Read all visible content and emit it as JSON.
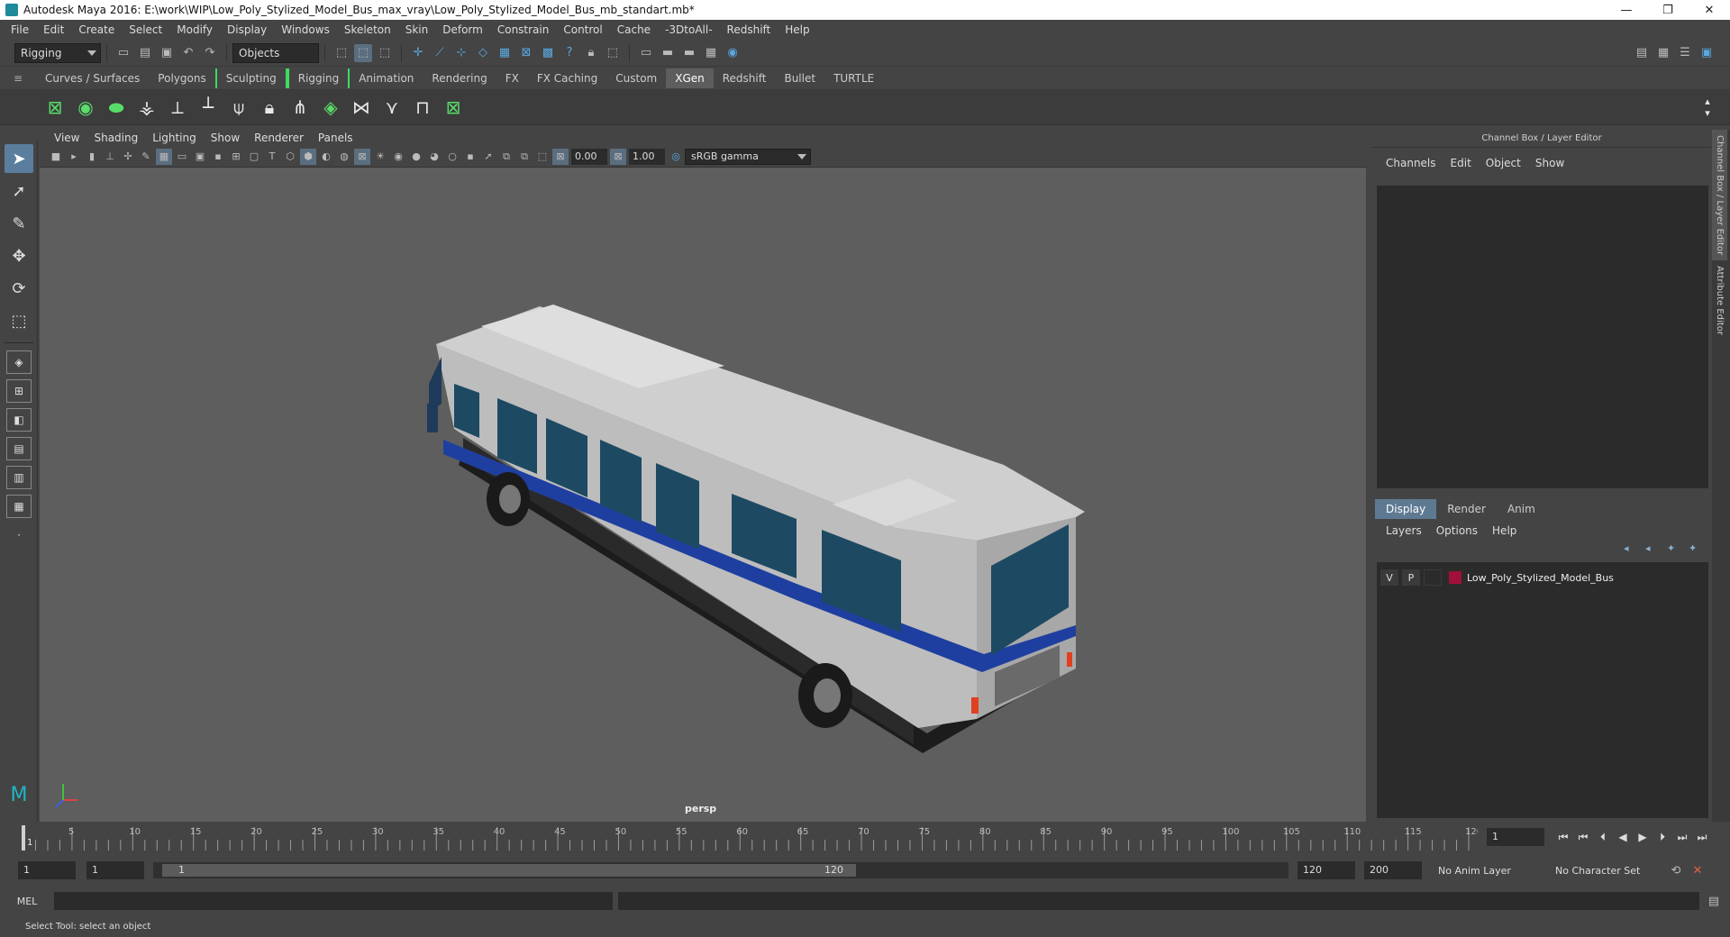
{
  "window": {
    "title": "Autodesk Maya 2016: E:\\work\\WIP\\Low_Poly_Stylized_Model_Bus_max_vray\\Low_Poly_Stylized_Model_Bus_mb_standart.mb*",
    "minimize": "—",
    "restore": "❐",
    "close": "✕"
  },
  "menubar": [
    "File",
    "Edit",
    "Create",
    "Select",
    "Modify",
    "Display",
    "Windows",
    "Skeleton",
    "Skin",
    "Deform",
    "Constrain",
    "Control",
    "Cache",
    "-3DtoAll-",
    "Redshift",
    "Help"
  ],
  "statusline": {
    "menuset": "Rigging",
    "selection_mode": "Objects"
  },
  "shelf": {
    "tabs": [
      "Curves / Surfaces",
      "Polygons",
      "Sculpting",
      "Rigging",
      "Animation",
      "Rendering",
      "FX",
      "FX Caching",
      "Custom",
      "XGen",
      "Redshift",
      "Bullet",
      "TURTLE"
    ],
    "active_tab": "XGen"
  },
  "viewport": {
    "menu": [
      "View",
      "Shading",
      "Lighting",
      "Show",
      "Renderer",
      "Panels"
    ],
    "exposure": "0.00",
    "gamma": "1.00",
    "color_space": "sRGB gamma",
    "camera_label": "persp"
  },
  "channel_box": {
    "title": "Channel Box / Layer Editor",
    "menu": [
      "Channels",
      "Edit",
      "Object",
      "Show"
    ],
    "layer_tabs": [
      "Display",
      "Render",
      "Anim"
    ],
    "active_layer_tab": "Display",
    "layer_menu": [
      "Layers",
      "Options",
      "Help"
    ],
    "layers": [
      {
        "v": "V",
        "p": "P",
        "name": "Low_Poly_Stylized_Model_Bus",
        "color": "#a0103a"
      }
    ]
  },
  "side_tabs": [
    "Channel Box / Layer Editor",
    "Attribute Editor"
  ],
  "timeline": {
    "start": 1,
    "end": 120,
    "major_labels": [
      5,
      10,
      15,
      20,
      25,
      30,
      35,
      40,
      45,
      50,
      55,
      60,
      65,
      70,
      75,
      80,
      85,
      90,
      95,
      100,
      105,
      110,
      115,
      120
    ],
    "current_frame": "1",
    "first_label": "1"
  },
  "range": {
    "start_field": "1",
    "start_field2": "1",
    "inner_start": "1",
    "inner_end": "120",
    "end_field": "120",
    "end_field2": "200",
    "anim_layer": "No Anim Layer",
    "character_set": "No Character Set"
  },
  "cmdline": {
    "label": "MEL"
  },
  "helpline": {
    "text": "Select Tool: select an object"
  }
}
